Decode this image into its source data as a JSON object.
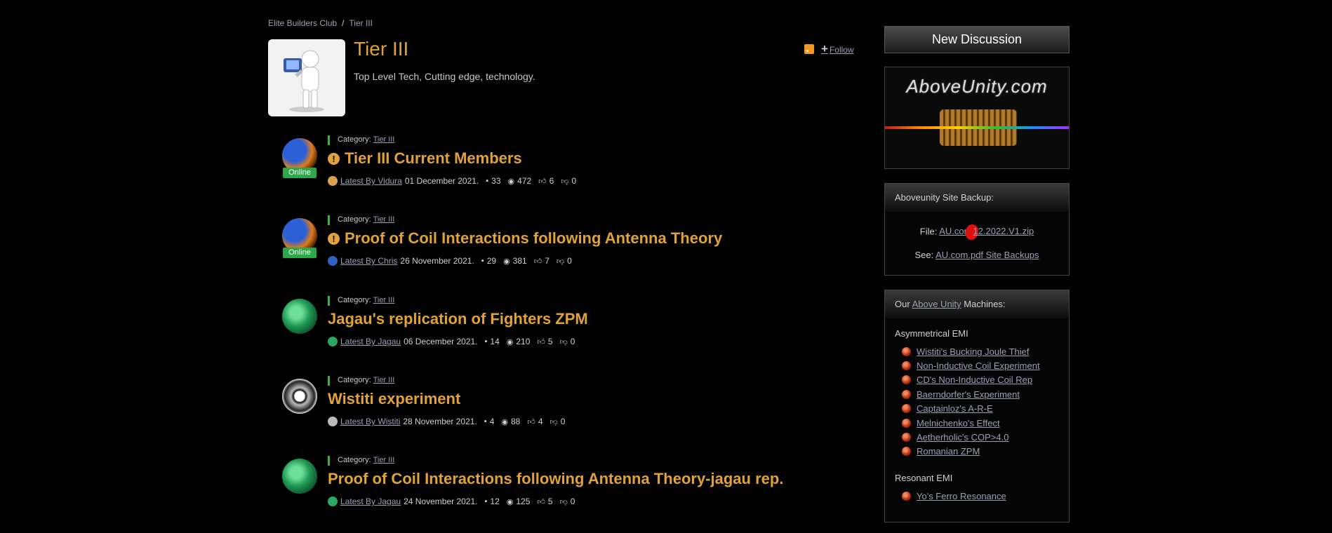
{
  "breadcrumb": {
    "root": "Elite Builders Club",
    "separator": "/",
    "current": "Tier III"
  },
  "category": {
    "title": "Tier III",
    "description": "Top Level Tech, Cutting edge, technology.",
    "follow_label": "Follow"
  },
  "discussions": [
    {
      "category_label": "Category:",
      "category": "Tier III",
      "title": "Tier III Current Members",
      "pinned": true,
      "online": true,
      "online_label": "Online",
      "latest_by": "Latest By",
      "author": "Vidura",
      "date": "01 December 2021.",
      "comments": "33",
      "views": "472",
      "likes": "6",
      "dislikes": "0"
    },
    {
      "category_label": "Category:",
      "category": "Tier III",
      "title": "Proof of Coil Interactions following Antenna Theory",
      "pinned": true,
      "online": true,
      "online_label": "Online",
      "latest_by": "Latest By",
      "author": "Chris",
      "date": "26 November 2021.",
      "comments": "29",
      "views": "381",
      "likes": "7",
      "dislikes": "0"
    },
    {
      "category_label": "Category:",
      "category": "Tier III",
      "title": "Jagau's replication of Fighters ZPM",
      "pinned": false,
      "online": false,
      "latest_by": "Latest By",
      "author": "Jagau",
      "date": "06 December 2021.",
      "comments": "14",
      "views": "210",
      "likes": "5",
      "dislikes": "0"
    },
    {
      "category_label": "Category:",
      "category": "Tier III",
      "title": "Wistiti experiment",
      "pinned": false,
      "online": false,
      "latest_by": "Latest By",
      "author": "Wistiti",
      "date": "28 November 2021.",
      "comments": "4",
      "views": "88",
      "likes": "4",
      "dislikes": "0"
    },
    {
      "category_label": "Category:",
      "category": "Tier III",
      "title": "Proof of Coil Interactions following Antenna Theory-jagau rep.",
      "pinned": false,
      "online": false,
      "latest_by": "Latest By",
      "author": "Jagau",
      "date": "24 November 2021.",
      "comments": "12",
      "views": "125",
      "likes": "5",
      "dislikes": "0"
    }
  ],
  "sidebar": {
    "new_discussion": "New Discussion",
    "banner_text": "AboveUnity.com",
    "backup": {
      "title": "Aboveunity Site Backup:",
      "file_label": "File:",
      "file_link_a": "AU.com",
      "file_link_b": "12.2022.V1.zip",
      "see_label": "See:",
      "see_link": "AU.com.pdf Site Backups"
    },
    "machines": {
      "title_prefix": "Our",
      "title_link": "Above Unity",
      "title_suffix": "Machines:",
      "group1": "Asymmetrical EMI",
      "items1": [
        "Wistiti's Bucking Joule Thief",
        "Non-Inductive Coil Experiment",
        "CD's Non-Inductive Coil Rep",
        "Baerndorfer's Experiment",
        "Captainloz's A-R-E",
        "Melnichenko's Effect",
        "Aetherholic's COP>4.0",
        "Romanian ZPM"
      ],
      "group2": "Resonant EMI",
      "items2": [
        "Yo's Ferro Resonance"
      ]
    }
  }
}
